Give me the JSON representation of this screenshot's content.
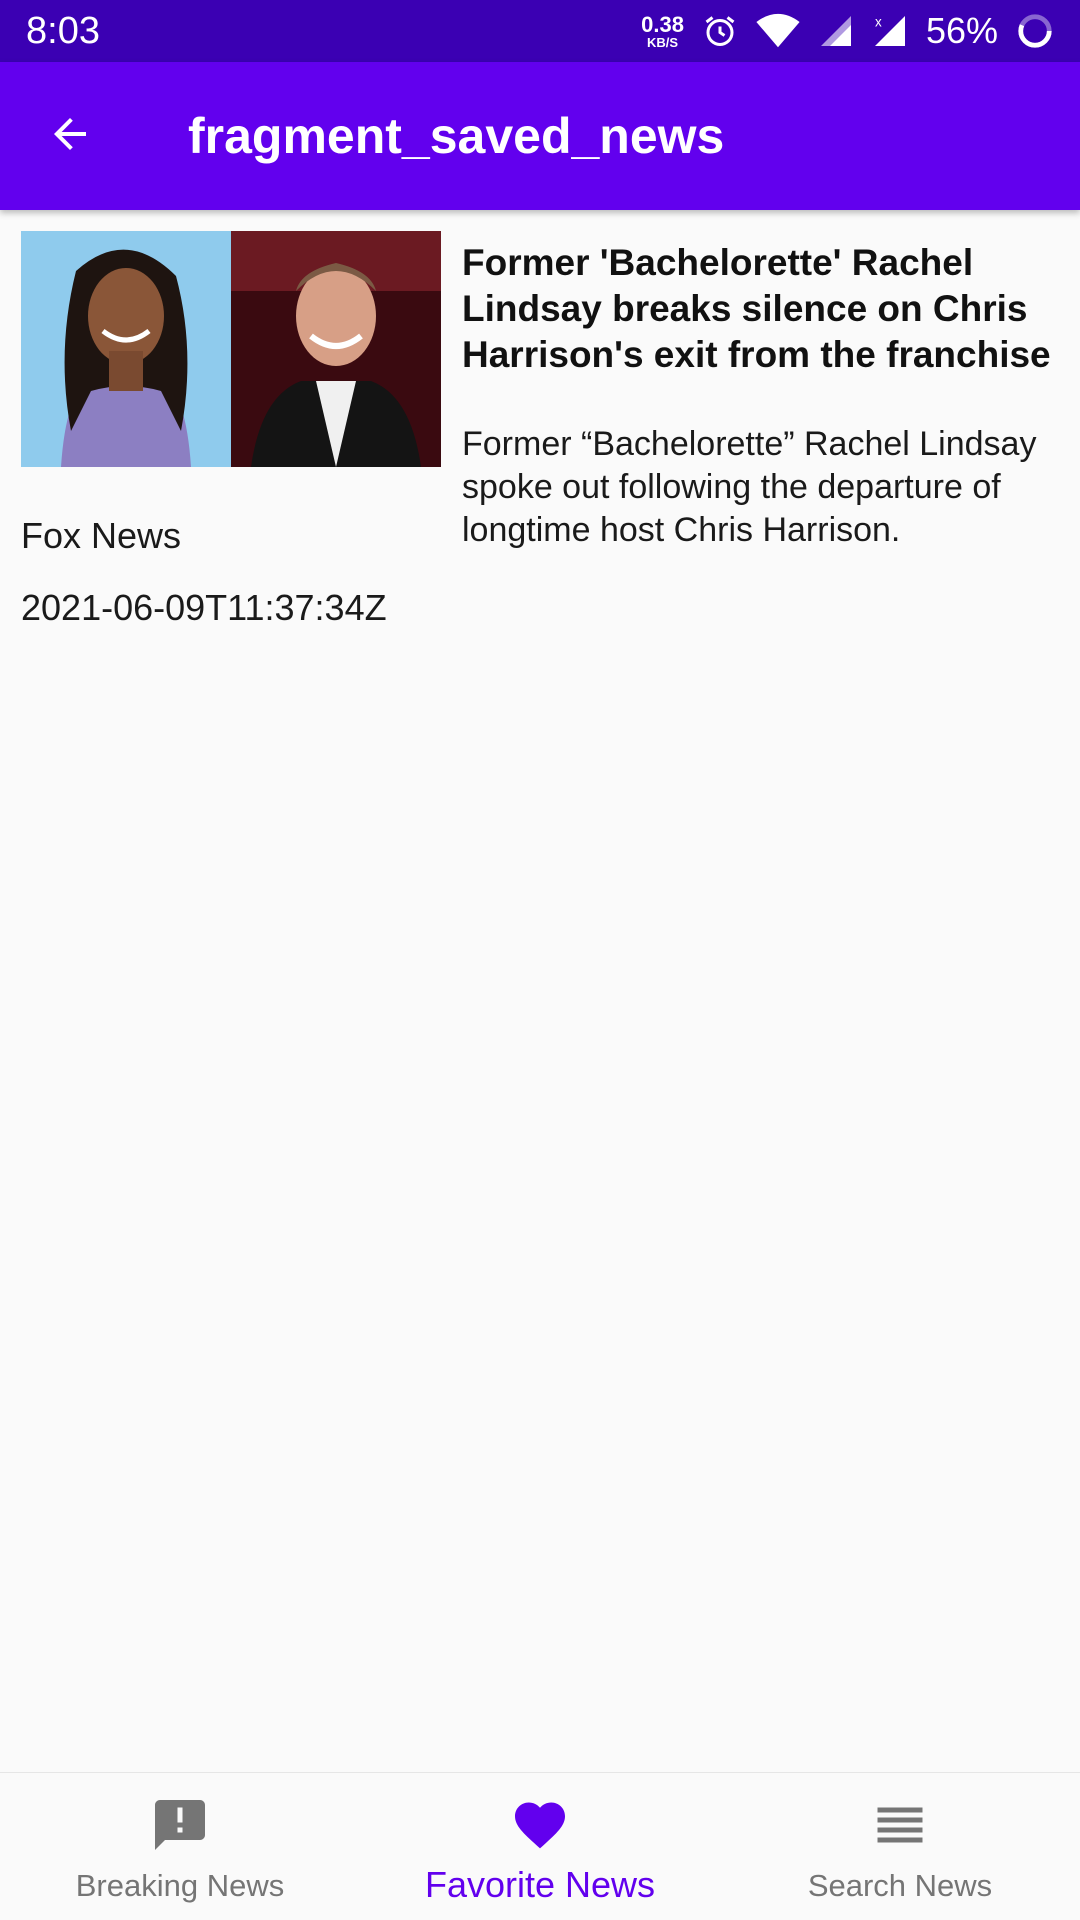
{
  "status_bar": {
    "time": "8:03",
    "net_speed_value": "0.38",
    "net_speed_unit": "KB/S",
    "battery": "56%",
    "icons": [
      "alarm-icon",
      "wifi-icon",
      "signal-icon",
      "signal-no-data-icon",
      "battery-icon"
    ]
  },
  "app_bar": {
    "title": "fragment_saved_news",
    "back_icon": "arrow-back-icon"
  },
  "articles": [
    {
      "title": "Former 'Bachelorette' Rachel Lindsay breaks silence on Chris Harrison's exit from the franchise",
      "description": "Former “Bachelorette” Rachel Lindsay spoke out following the departure of longtime host Chris Harrison.",
      "source": "Fox News",
      "published_at": "2021-06-09T11:37:34Z"
    }
  ],
  "bottom_nav": {
    "items": [
      {
        "label": "Breaking News",
        "icon": "announcement-icon",
        "active": false
      },
      {
        "label": "Favorite News",
        "icon": "heart-icon",
        "active": true
      },
      {
        "label": "Search News",
        "icon": "list-icon",
        "active": false
      }
    ]
  },
  "colors": {
    "status_bar": "#3b00b3",
    "primary": "#6200ee",
    "nav_inactive": "#757575",
    "background": "#fafafa"
  }
}
